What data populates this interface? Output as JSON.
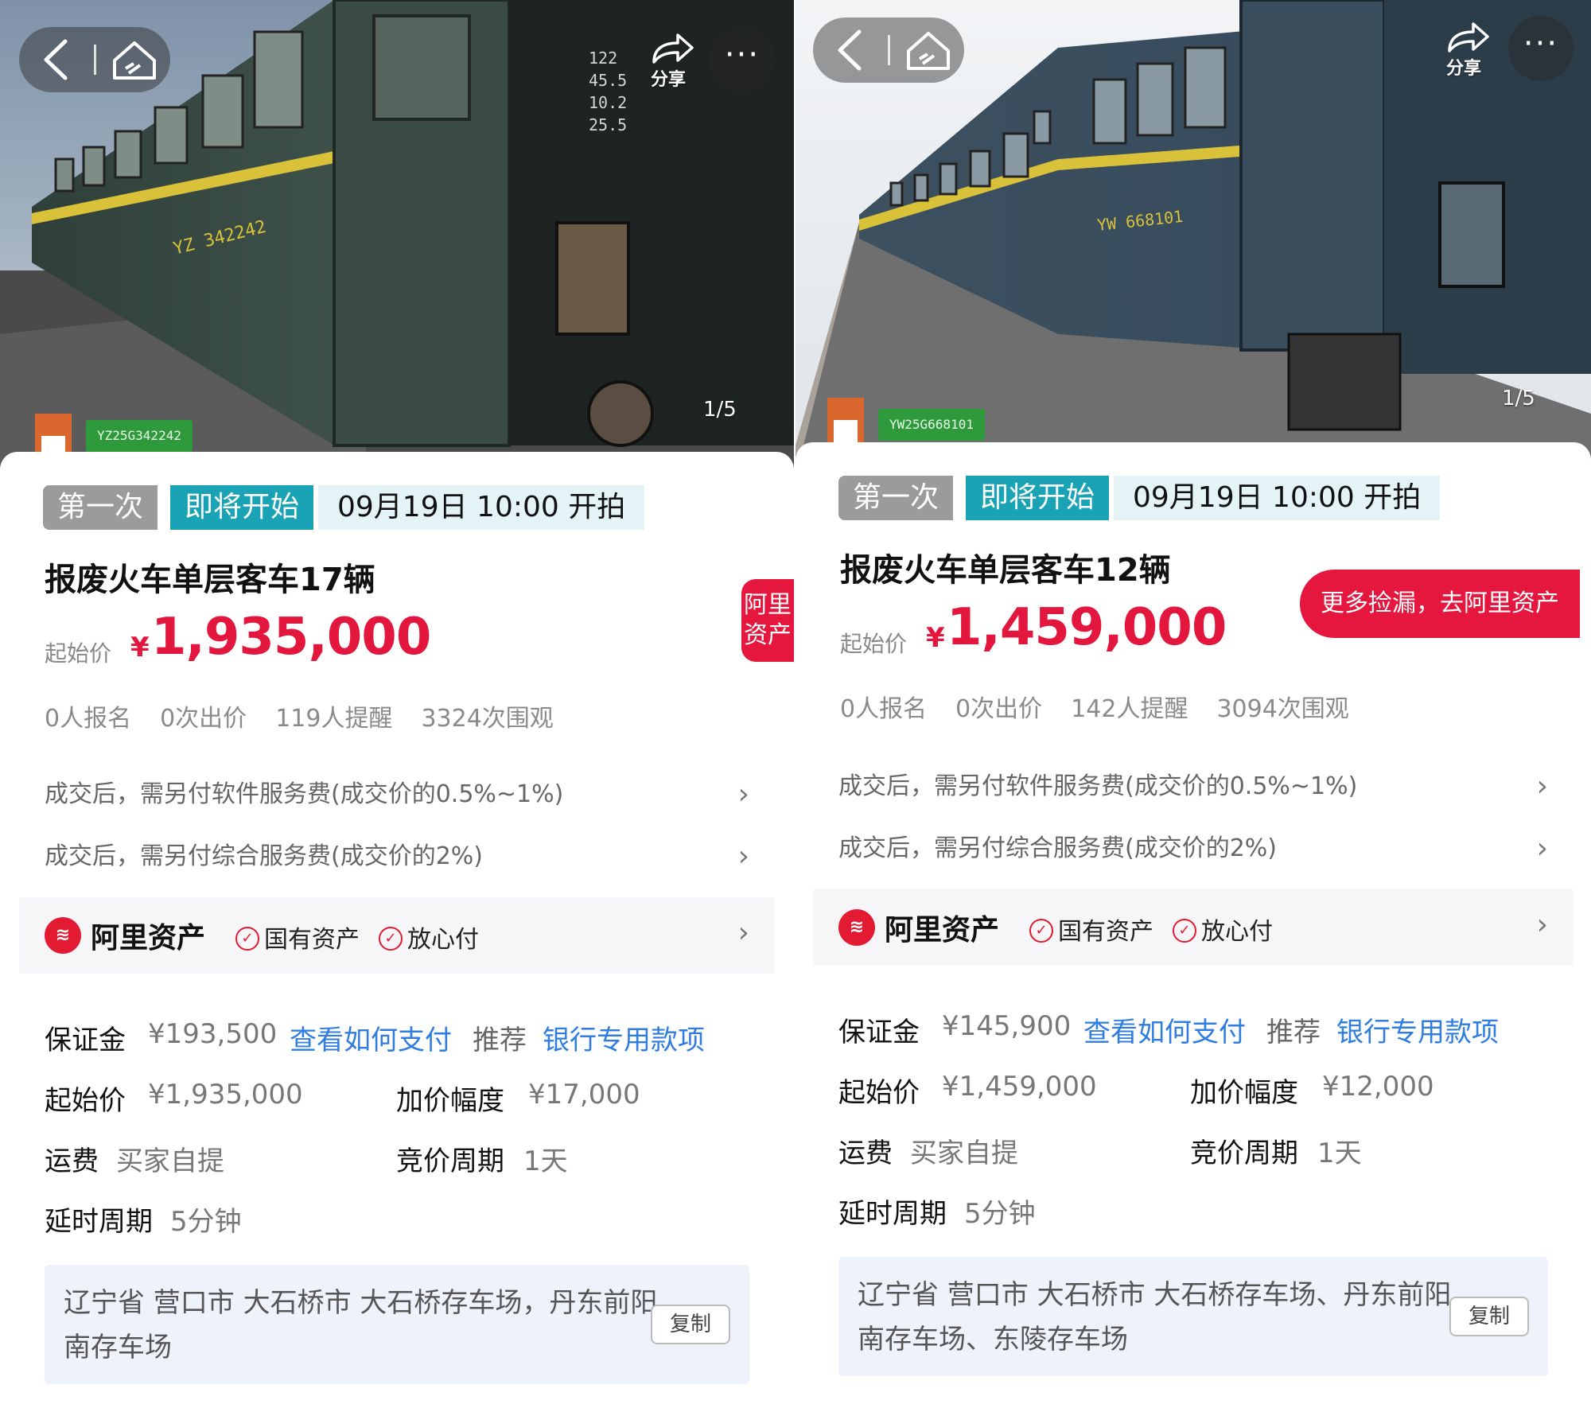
{
  "screens": [
    {
      "nav": {
        "share_label": "分享",
        "more_label": "···"
      },
      "photo": {
        "counter": "1/5",
        "plate": "YZ25G342242",
        "car_number": "YZ 342242"
      },
      "tags": {
        "round": "第一次",
        "status": "即将开始",
        "start_time": "09月19日 10:00 开拍"
      },
      "title": "报废火车单层客车17辆",
      "price": {
        "label": "起始价",
        "currency": "¥",
        "value": "1,935,000"
      },
      "stats": [
        "0人报名",
        "0次出价",
        "119人提醒",
        "3324次围观"
      ],
      "side_tab": "阿里资产",
      "fees": [
        "成交后，需另付软件服务费(成交价的0.5%~1%)",
        "成交后，需另付综合服务费(成交价的2%)"
      ],
      "brand": {
        "name": "阿里资产",
        "badges": [
          "国有资产",
          "放心付"
        ]
      },
      "details": {
        "deposit_label": "保证金",
        "deposit_value": "¥193,500",
        "deposit_link": "查看如何支付",
        "recommend_label": "推荐",
        "recommend_link": "银行专用款项",
        "start_label": "起始价",
        "start_value": "¥1,935,000",
        "increment_label": "加价幅度",
        "increment_value": "¥17,000",
        "freight_label": "运费",
        "freight_value": "买家自提",
        "cycle_label": "竞价周期",
        "cycle_value": "1天",
        "delay_label": "延时周期",
        "delay_value": "5分钟"
      },
      "address": {
        "text": "辽宁省 营口市 大石桥市 大石桥存车场，丹东前阳南存车场",
        "copy_label": "复制"
      }
    },
    {
      "nav": {
        "share_label": "分享",
        "more_label": "···"
      },
      "photo": {
        "counter": "1/5",
        "plate": "YW25G668101",
        "car_number": "YW 668101"
      },
      "tags": {
        "round": "第一次",
        "status": "即将开始",
        "start_time": "09月19日 10:00 开拍"
      },
      "title": "报废火车单层客车12辆",
      "price": {
        "label": "起始价",
        "currency": "¥",
        "value": "1,459,000"
      },
      "stats": [
        "0人报名",
        "0次出价",
        "142人提醒",
        "3094次围观"
      ],
      "promo": "更多捡漏，去阿里资产",
      "fees": [
        "成交后，需另付软件服务费(成交价的0.5%~1%)",
        "成交后，需另付综合服务费(成交价的2%)"
      ],
      "brand": {
        "name": "阿里资产",
        "badges": [
          "国有资产",
          "放心付"
        ]
      },
      "details": {
        "deposit_label": "保证金",
        "deposit_value": "¥145,900",
        "deposit_link": "查看如何支付",
        "recommend_label": "推荐",
        "recommend_link": "银行专用款项",
        "start_label": "起始价",
        "start_value": "¥1,459,000",
        "increment_label": "加价幅度",
        "increment_value": "¥12,000",
        "freight_label": "运费",
        "freight_value": "买家自提",
        "cycle_label": "竞价周期",
        "cycle_value": "1天",
        "delay_label": "延时周期",
        "delay_value": "5分钟"
      },
      "address": {
        "text": "辽宁省 营口市 大石桥市 大石桥存车场、丹东前阳南存车场、东陵存车场",
        "copy_label": "复制"
      }
    }
  ],
  "colors": {
    "accent_red": "#e3173d",
    "teal_tag": "#1aa3b5",
    "link_blue": "#2f7de0",
    "train_green": "#3c4f45",
    "stripe_yellow": "#d9c23a"
  }
}
